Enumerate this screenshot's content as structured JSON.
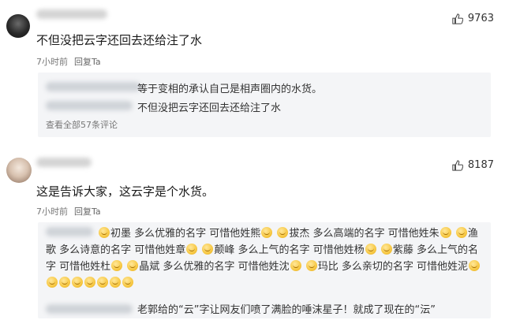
{
  "comments": [
    {
      "likes": "9763",
      "text": "不但没把云字还回去还给注了水",
      "time": "7小时前",
      "reply_label": "回复Ta",
      "replies": [
        {
          "text": "等于变相的承认自己是相声圈内的水货。"
        },
        {
          "text": "不但没把云字还回去还给注了水"
        }
      ],
      "view_more": "查看全部57条评论"
    },
    {
      "likes": "8187",
      "text": "这是告诉大家，这云字是个水货。",
      "time": "7小时前",
      "reply_label": "回复Ta",
      "long_reply": {
        "segments": [
          "初墨 多么优雅的名字 可惜他姓熊",
          "拔杰 多么高端的名字 可惜他姓朱",
          "渔歌 多么诗意的名字 可惜他姓章",
          "颠峰 多么上气的名字 可惜他姓杨",
          "紫藤 多么上气的名字 可惜他姓杜",
          "晶斌 多么优雅的名字 可惜他姓沈",
          "玛比 多么亲切的名字 可惜他姓泥"
        ]
      },
      "last_reply": "老郭给的“云”字让网友们喷了满脸的唾沫星子！就成了现在的“沄”"
    }
  ],
  "icons": {
    "like": "thumbs-up-icon",
    "emoji": "smile-emoji-icon"
  },
  "colors": {
    "sub_bg": "#f4f5f7",
    "meta": "#777777",
    "emoji": "#f7c843"
  }
}
